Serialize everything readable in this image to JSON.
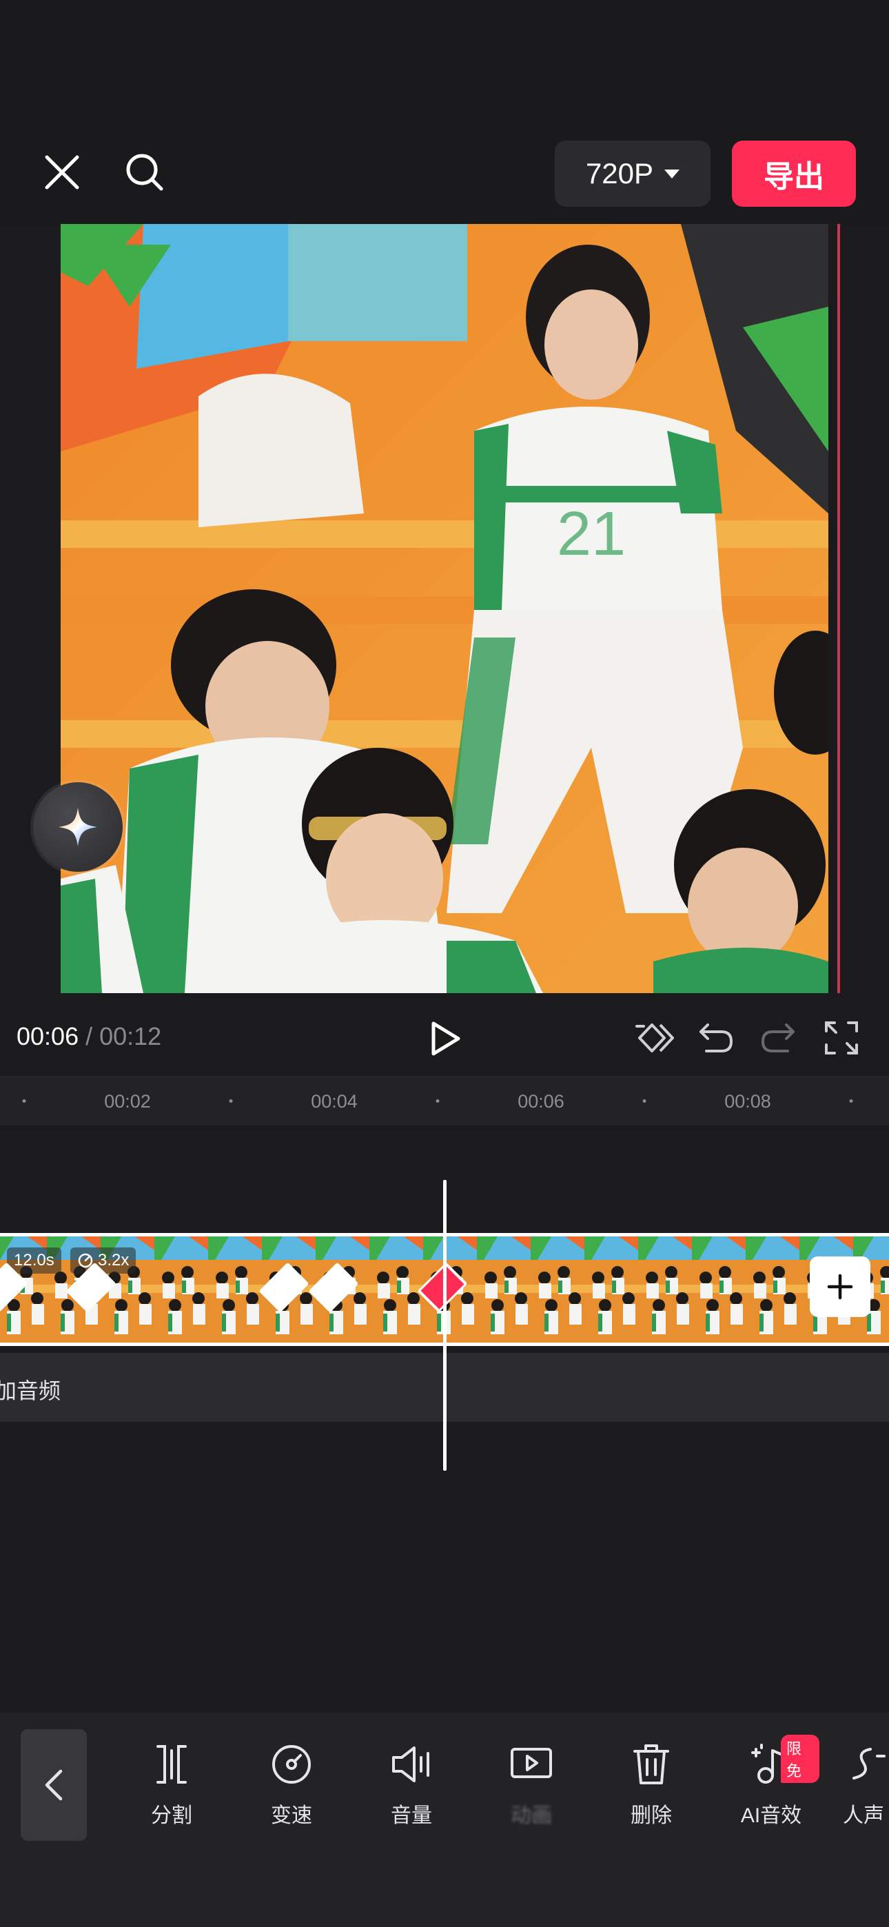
{
  "header": {
    "resolution": "720P",
    "export_label": "导出"
  },
  "preview": {
    "image_description_icon": "video-frame"
  },
  "playback": {
    "current_time": "00:06",
    "separator": "/",
    "total_time": "00:12"
  },
  "ruler": {
    "ticks": [
      "00:02",
      "00:04",
      "00:06",
      "00:08"
    ]
  },
  "clip": {
    "duration": "12.0s",
    "speed": "3.2x"
  },
  "audio_track": {
    "label": "加音频"
  },
  "toolbar": {
    "items": [
      {
        "label": "分割",
        "icon": "split-icon"
      },
      {
        "label": "变速",
        "icon": "speed-icon"
      },
      {
        "label": "音量",
        "icon": "volume-icon"
      },
      {
        "label": "动画",
        "icon": "animation-icon"
      },
      {
        "label": "删除",
        "icon": "delete-icon"
      },
      {
        "label": "AI音效",
        "icon": "ai-sound-icon",
        "badge": "限免"
      },
      {
        "label": "人声",
        "icon": "voice-icon"
      }
    ]
  },
  "colors": {
    "accent": "#fe2c55",
    "background": "#1b1b1d"
  }
}
